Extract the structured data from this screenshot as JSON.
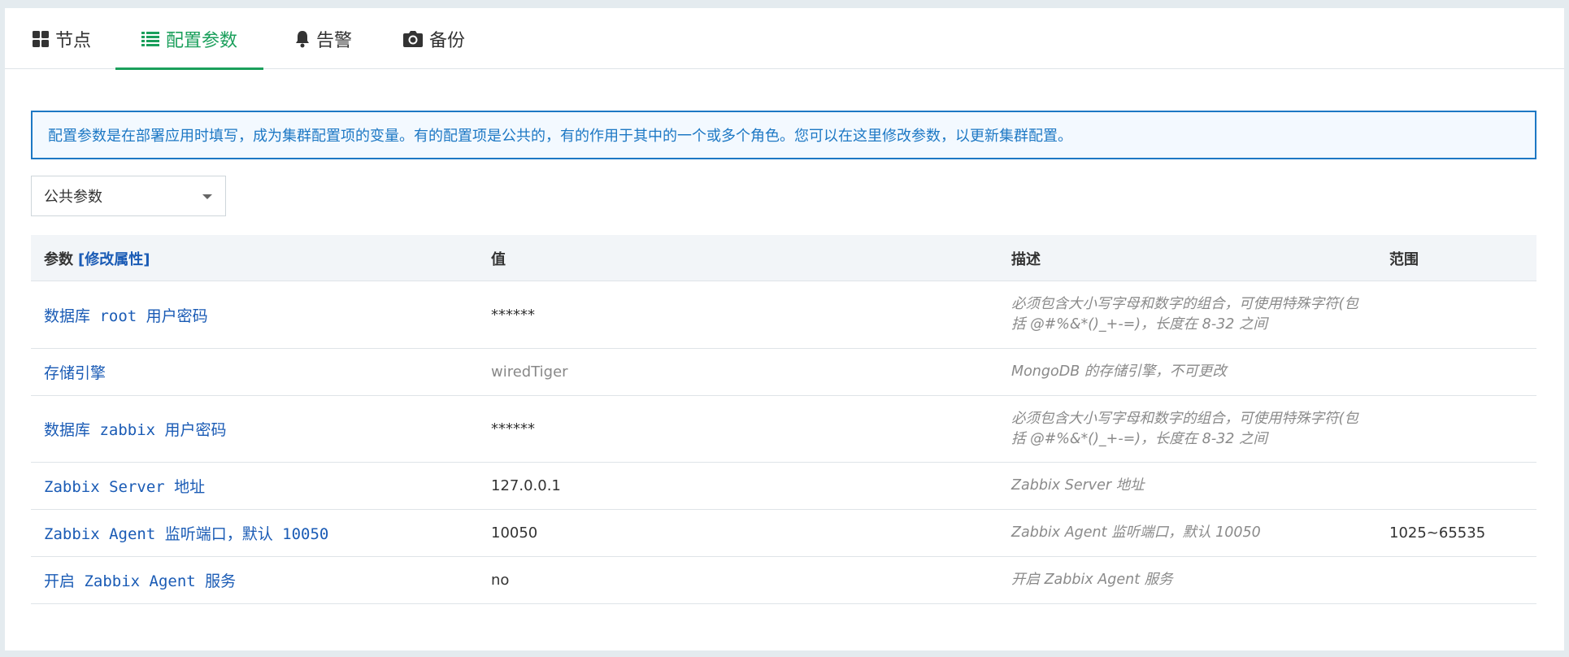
{
  "tabs": [
    {
      "label": "节点",
      "icon": "grid-icon",
      "active": false
    },
    {
      "label": "配置参数",
      "icon": "list-icon",
      "active": true
    },
    {
      "label": "告警",
      "icon": "bell-icon",
      "active": false
    },
    {
      "label": "备份",
      "icon": "camera-icon",
      "active": false
    }
  ],
  "info_text": "配置参数是在部署应用时填写，成为集群配置项的变量。有的配置项是公共的，有的作用于其中的一个或多个角色。您可以在这里修改参数，以更新集群配置。",
  "select": {
    "value": "公共参数"
  },
  "table": {
    "headers": {
      "param": "参数",
      "param_link": "[修改属性]",
      "value": "值",
      "desc": "描述",
      "range": "范围"
    },
    "rows": [
      {
        "name": "数据库 root 用户密码",
        "value": "******",
        "desc": "必须包含大小写字母和数字的组合，可使用特殊字符(包括 @#%&*()_+-=)，长度在 8-32 之间",
        "range": ""
      },
      {
        "name": "存储引擎",
        "value": "wiredTiger",
        "desc": "MongoDB 的存储引擎，不可更改",
        "range": ""
      },
      {
        "name": "数据库 zabbix 用户密码",
        "value": "******",
        "desc": "必须包含大小写字母和数字的组合，可使用特殊字符(包括 @#%&*()_+-=)，长度在 8-32 之间",
        "range": ""
      },
      {
        "name": "Zabbix Server 地址",
        "value": "127.0.0.1",
        "desc": "Zabbix Server 地址",
        "range": ""
      },
      {
        "name": "Zabbix Agent 监听端口，默认 10050",
        "value": "10050",
        "desc": "Zabbix Agent 监听端口，默认 10050",
        "range": "1025~65535"
      },
      {
        "name": "开启 Zabbix Agent 服务",
        "value": "no",
        "desc": "开启 Zabbix Agent 服务",
        "range": ""
      }
    ]
  },
  "colors": {
    "accent_green": "#1a9f5b",
    "link_blue": "#1a5bb5",
    "info_blue": "#1d78c4"
  }
}
